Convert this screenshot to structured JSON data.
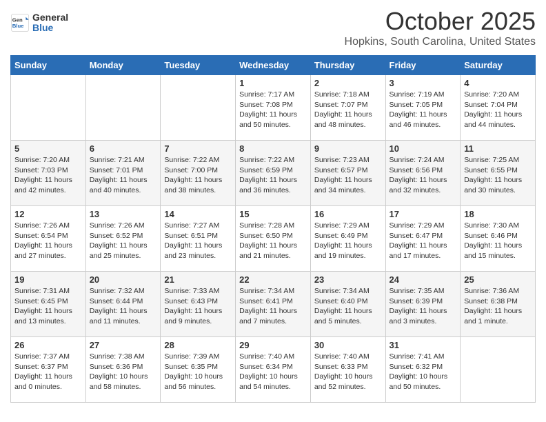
{
  "header": {
    "logo_general": "General",
    "logo_blue": "Blue",
    "month": "October 2025",
    "location": "Hopkins, South Carolina, United States"
  },
  "days_of_week": [
    "Sunday",
    "Monday",
    "Tuesday",
    "Wednesday",
    "Thursday",
    "Friday",
    "Saturday"
  ],
  "weeks": [
    [
      {
        "day": "",
        "info": ""
      },
      {
        "day": "",
        "info": ""
      },
      {
        "day": "",
        "info": ""
      },
      {
        "day": "1",
        "info": "Sunrise: 7:17 AM\nSunset: 7:08 PM\nDaylight: 11 hours\nand 50 minutes."
      },
      {
        "day": "2",
        "info": "Sunrise: 7:18 AM\nSunset: 7:07 PM\nDaylight: 11 hours\nand 48 minutes."
      },
      {
        "day": "3",
        "info": "Sunrise: 7:19 AM\nSunset: 7:05 PM\nDaylight: 11 hours\nand 46 minutes."
      },
      {
        "day": "4",
        "info": "Sunrise: 7:20 AM\nSunset: 7:04 PM\nDaylight: 11 hours\nand 44 minutes."
      }
    ],
    [
      {
        "day": "5",
        "info": "Sunrise: 7:20 AM\nSunset: 7:03 PM\nDaylight: 11 hours\nand 42 minutes."
      },
      {
        "day": "6",
        "info": "Sunrise: 7:21 AM\nSunset: 7:01 PM\nDaylight: 11 hours\nand 40 minutes."
      },
      {
        "day": "7",
        "info": "Sunrise: 7:22 AM\nSunset: 7:00 PM\nDaylight: 11 hours\nand 38 minutes."
      },
      {
        "day": "8",
        "info": "Sunrise: 7:22 AM\nSunset: 6:59 PM\nDaylight: 11 hours\nand 36 minutes."
      },
      {
        "day": "9",
        "info": "Sunrise: 7:23 AM\nSunset: 6:57 PM\nDaylight: 11 hours\nand 34 minutes."
      },
      {
        "day": "10",
        "info": "Sunrise: 7:24 AM\nSunset: 6:56 PM\nDaylight: 11 hours\nand 32 minutes."
      },
      {
        "day": "11",
        "info": "Sunrise: 7:25 AM\nSunset: 6:55 PM\nDaylight: 11 hours\nand 30 minutes."
      }
    ],
    [
      {
        "day": "12",
        "info": "Sunrise: 7:26 AM\nSunset: 6:54 PM\nDaylight: 11 hours\nand 27 minutes."
      },
      {
        "day": "13",
        "info": "Sunrise: 7:26 AM\nSunset: 6:52 PM\nDaylight: 11 hours\nand 25 minutes."
      },
      {
        "day": "14",
        "info": "Sunrise: 7:27 AM\nSunset: 6:51 PM\nDaylight: 11 hours\nand 23 minutes."
      },
      {
        "day": "15",
        "info": "Sunrise: 7:28 AM\nSunset: 6:50 PM\nDaylight: 11 hours\nand 21 minutes."
      },
      {
        "day": "16",
        "info": "Sunrise: 7:29 AM\nSunset: 6:49 PM\nDaylight: 11 hours\nand 19 minutes."
      },
      {
        "day": "17",
        "info": "Sunrise: 7:29 AM\nSunset: 6:47 PM\nDaylight: 11 hours\nand 17 minutes."
      },
      {
        "day": "18",
        "info": "Sunrise: 7:30 AM\nSunset: 6:46 PM\nDaylight: 11 hours\nand 15 minutes."
      }
    ],
    [
      {
        "day": "19",
        "info": "Sunrise: 7:31 AM\nSunset: 6:45 PM\nDaylight: 11 hours\nand 13 minutes."
      },
      {
        "day": "20",
        "info": "Sunrise: 7:32 AM\nSunset: 6:44 PM\nDaylight: 11 hours\nand 11 minutes."
      },
      {
        "day": "21",
        "info": "Sunrise: 7:33 AM\nSunset: 6:43 PM\nDaylight: 11 hours\nand 9 minutes."
      },
      {
        "day": "22",
        "info": "Sunrise: 7:34 AM\nSunset: 6:41 PM\nDaylight: 11 hours\nand 7 minutes."
      },
      {
        "day": "23",
        "info": "Sunrise: 7:34 AM\nSunset: 6:40 PM\nDaylight: 11 hours\nand 5 minutes."
      },
      {
        "day": "24",
        "info": "Sunrise: 7:35 AM\nSunset: 6:39 PM\nDaylight: 11 hours\nand 3 minutes."
      },
      {
        "day": "25",
        "info": "Sunrise: 7:36 AM\nSunset: 6:38 PM\nDaylight: 11 hours\nand 1 minute."
      }
    ],
    [
      {
        "day": "26",
        "info": "Sunrise: 7:37 AM\nSunset: 6:37 PM\nDaylight: 11 hours\nand 0 minutes."
      },
      {
        "day": "27",
        "info": "Sunrise: 7:38 AM\nSunset: 6:36 PM\nDaylight: 10 hours\nand 58 minutes."
      },
      {
        "day": "28",
        "info": "Sunrise: 7:39 AM\nSunset: 6:35 PM\nDaylight: 10 hours\nand 56 minutes."
      },
      {
        "day": "29",
        "info": "Sunrise: 7:40 AM\nSunset: 6:34 PM\nDaylight: 10 hours\nand 54 minutes."
      },
      {
        "day": "30",
        "info": "Sunrise: 7:40 AM\nSunset: 6:33 PM\nDaylight: 10 hours\nand 52 minutes."
      },
      {
        "day": "31",
        "info": "Sunrise: 7:41 AM\nSunset: 6:32 PM\nDaylight: 10 hours\nand 50 minutes."
      },
      {
        "day": "",
        "info": ""
      }
    ]
  ]
}
